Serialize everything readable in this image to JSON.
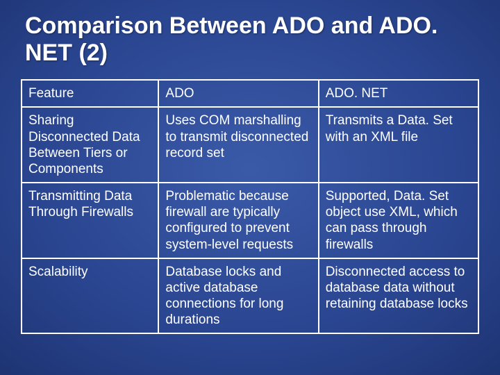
{
  "title": "Comparison Between ADO and ADO. NET (2)",
  "table": {
    "headers": [
      "Feature",
      "ADO",
      "ADO. NET"
    ],
    "rows": [
      {
        "feature": "Sharing Disconnected Data Between Tiers or Components",
        "ado": "Uses COM marshalling to transmit disconnected record set",
        "adonet": "Transmits a Data. Set with an XML file"
      },
      {
        "feature": "Transmitting Data Through Firewalls",
        "ado": "Problematic because firewall are typically configured to prevent system-level requests",
        "adonet": "Supported, Data. Set object use XML, which can pass through firewalls"
      },
      {
        "feature": "Scalability",
        "ado": "Database locks and active database connections for long durations",
        "adonet": "Disconnected access to database data without retaining database locks"
      }
    ]
  }
}
